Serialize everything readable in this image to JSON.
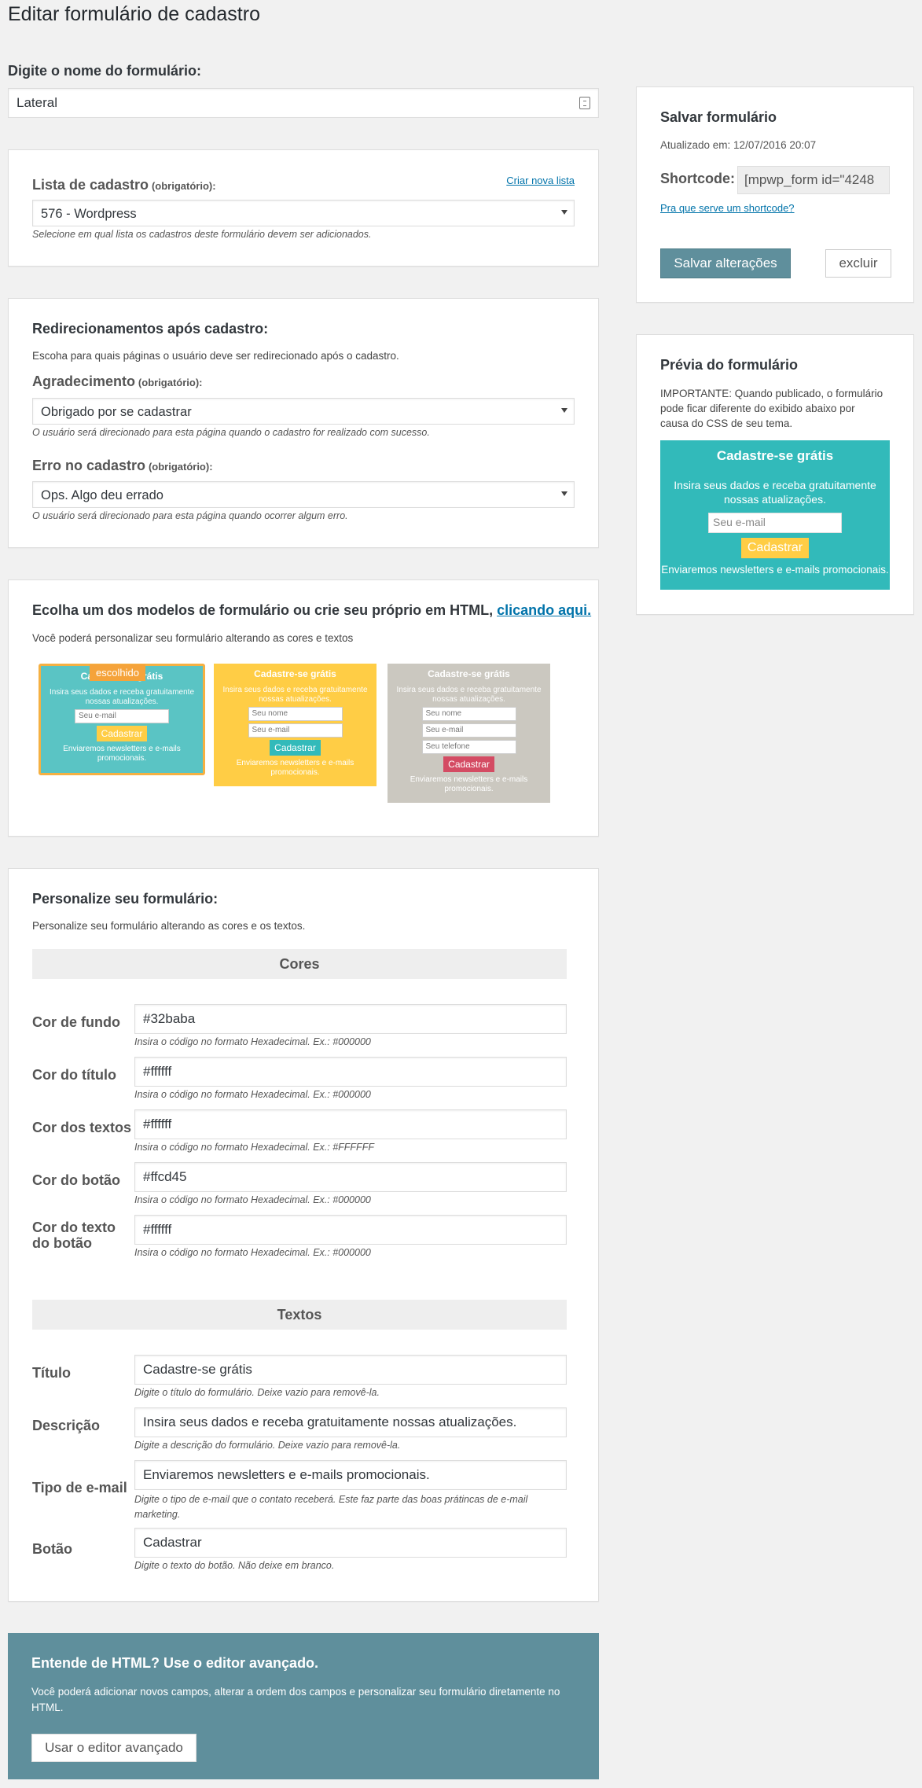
{
  "page": {
    "title": "Editar formulário de cadastro"
  },
  "form_name": {
    "label": "Digite o nome do formulário:",
    "value": "Lateral"
  },
  "list_box": {
    "label": "Lista de cadastro",
    "required": "(obrigatório):",
    "create_link": "Criar nova lista",
    "selected": "576 - Wordpress",
    "help": "Selecione em qual lista os cadastros deste formulário devem ser adicionados."
  },
  "redirect_box": {
    "title": "Redirecionamentos após cadastro:",
    "desc": "Escoha para quais páginas o usuário deve ser redirecionado após o cadastro.",
    "thanks_label": "Agradecimento",
    "thanks_required": "(obrigatório):",
    "thanks_selected": "Obrigado por se cadastrar",
    "thanks_help": "O usuário será direcionado para esta página quando o cadastro for realizado com sucesso.",
    "error_label": "Erro no cadastro",
    "error_required": "(obrigatório):",
    "error_selected": "Ops. Algo deu errado",
    "error_help": "O usuário será direcionado para esta página quando ocorrer algum erro."
  },
  "templates_box": {
    "title": "Ecolha um dos modelos de formulário ou crie seu próprio em HTML,",
    "title_link": "clicando aqui.",
    "desc": "Você poderá personalizar seu formulário alterando as cores e textos",
    "chosen_badge": "escolhido",
    "tpl1": {
      "title": "Cadastre-se grátis",
      "desc": "Insira seus dados e receba gratuitamente nossas atualizações.",
      "email": "Seu e-mail",
      "button": "Cadastrar",
      "foot": "Enviaremos newsletters e e-mails promocionais."
    },
    "tpl2": {
      "title": "Cadastre-se grátis",
      "desc": "Insira seus dados e receba gratuitamente nossas atualizações.",
      "name": "Seu nome",
      "email": "Seu e-mail",
      "button": "Cadastrar",
      "foot": "Enviaremos newsletters e e-mails promocionais."
    },
    "tpl3": {
      "title": "Cadastre-se grátis",
      "desc": "Insira seus dados e receba gratuitamente nossas atualizações.",
      "name": "Seu nome",
      "email": "Seu e-mail",
      "phone": "Seu telefone",
      "button": "Cadastrar",
      "foot": "Enviaremos newsletters e e-mails promocionais."
    }
  },
  "customize_box": {
    "title": "Personalize seu formulário:",
    "desc": "Personalize seu formulário alterando as cores e os textos.",
    "colors_heading": "Cores",
    "bg_label": "Cor de fundo",
    "bg_value": "#32baba",
    "bg_help": "Insira o código no formato Hexadecimal. Ex.: #000000",
    "title_color_label": "Cor do título",
    "title_color_value": "#ffffff",
    "title_color_help": "Insira o código no formato Hexadecimal. Ex.: #000000",
    "text_color_label": "Cor dos textos",
    "text_color_value": "#ffffff",
    "text_color_help": "Insira o código no formato Hexadecimal. Ex.: #FFFFFF",
    "btn_color_label": "Cor do botão",
    "btn_color_value": "#ffcd45",
    "btn_color_help": "Insira o código no formato Hexadecimal. Ex.: #000000",
    "btn_text_color_label_1": "Cor do texto",
    "btn_text_color_label_2": "do botão",
    "btn_text_color_value": "#ffffff",
    "btn_text_color_help": "Insira o código no formato Hexadecimal. Ex.: #000000",
    "texts_heading": "Textos",
    "title_label": "Título",
    "title_value": "Cadastre-se grátis",
    "title_help": "Digite o título do formulário. Deixe vazio para removê-la.",
    "desc_label": "Descrição",
    "desc_value": "Insira seus dados e receba gratuitamente nossas atualizações.",
    "desc_help": "Digite a descrição do formulário. Deixe vazio para removê-la.",
    "email_label": "Tipo de e-mail",
    "email_value": "Enviaremos newsletters e e-mails promocionais.",
    "email_help_1": "Digite o tipo de e-mail que o contato receberá. Este faz parte das boas prátincas de e-mail",
    "email_help_2": "marketing.",
    "button_label": "Botão",
    "button_value": "Cadastrar",
    "button_help": "Digite o texto do botão. Não deixe em branco."
  },
  "html_box": {
    "title": "Entende de HTML? Use o editor avançado.",
    "desc_1": "Você poderá adicionar novos campos, alterar a ordem dos campos e personalizar seu formulário diretamente no",
    "desc_2": "HTML.",
    "button": "Usar o editor avançado"
  },
  "save_box": {
    "title": "Salvar formulário",
    "updated": "Atualizado em: 12/07/2016 20:07",
    "shortcode_label": "Shortcode:",
    "shortcode_value": "[mpwp_form id=\"4248",
    "shortcode_link": "Pra que serve um shortcode?",
    "save_button": "Salvar alterações",
    "delete_button": "excluir"
  },
  "preview_box": {
    "title": "Prévia do formulário",
    "notice_1": "IMPORTANTE: Quando publicado, o formulário",
    "notice_2": "pode ficar diferente do exibido abaixo por",
    "notice_3": "causa do CSS de seu tema.",
    "card_title": "Cadastre-se grátis",
    "card_desc": "Insira seus dados e receba gratuitamente nossas atualizações.",
    "card_email": "Seu e-mail",
    "card_button": "Cadastrar",
    "card_foot": "Enviaremos newsletters e e-mails promocionais."
  },
  "colors": {
    "preview_bg": "#32baba",
    "button_yellow": "#ffcd45",
    "tpl2_bg": "#ffcd45",
    "tpl3_bg": "#cbc8c0",
    "tpl3_btn": "#d44b63",
    "accent": "#5f8f9c"
  }
}
